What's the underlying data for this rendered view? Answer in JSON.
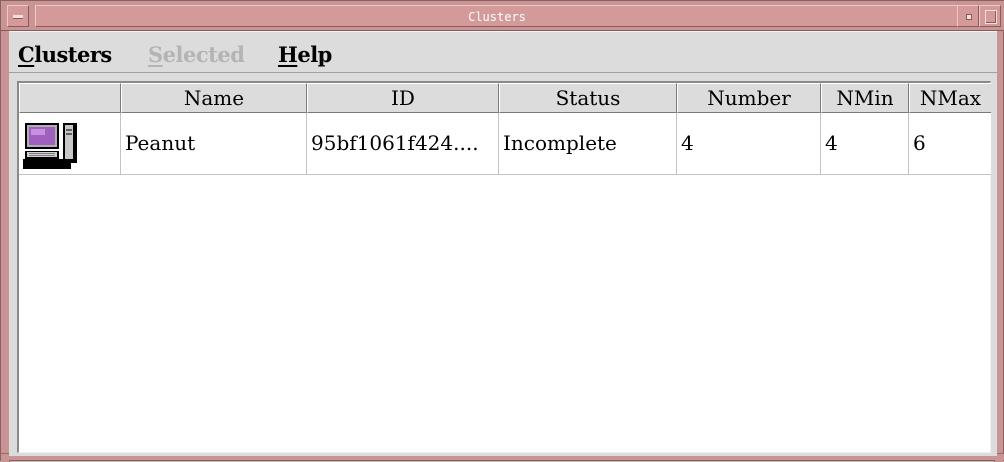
{
  "window": {
    "title": "Clusters"
  },
  "menubar": {
    "items": [
      {
        "mnemonic": "C",
        "rest": "lusters",
        "enabled": true
      },
      {
        "mnemonic": "S",
        "rest": "elected",
        "enabled": false
      },
      {
        "mnemonic": "H",
        "rest": "elp",
        "enabled": true
      }
    ]
  },
  "table": {
    "columns": [
      "",
      "Name",
      "ID",
      "Status",
      "Number",
      "NMin",
      "NMax"
    ],
    "rows": [
      {
        "icon": "cluster-computer-icon",
        "name": "Peanut",
        "id": "95bf1061f424....",
        "status": "Incomplete",
        "number": "4",
        "nmin": "4",
        "nmax": "6"
      }
    ]
  },
  "colors": {
    "frame": "#c89494",
    "menu_bg": "#dcdcdc",
    "disabled_text": "#b4b4b4",
    "table_bg": "#ffffff"
  }
}
